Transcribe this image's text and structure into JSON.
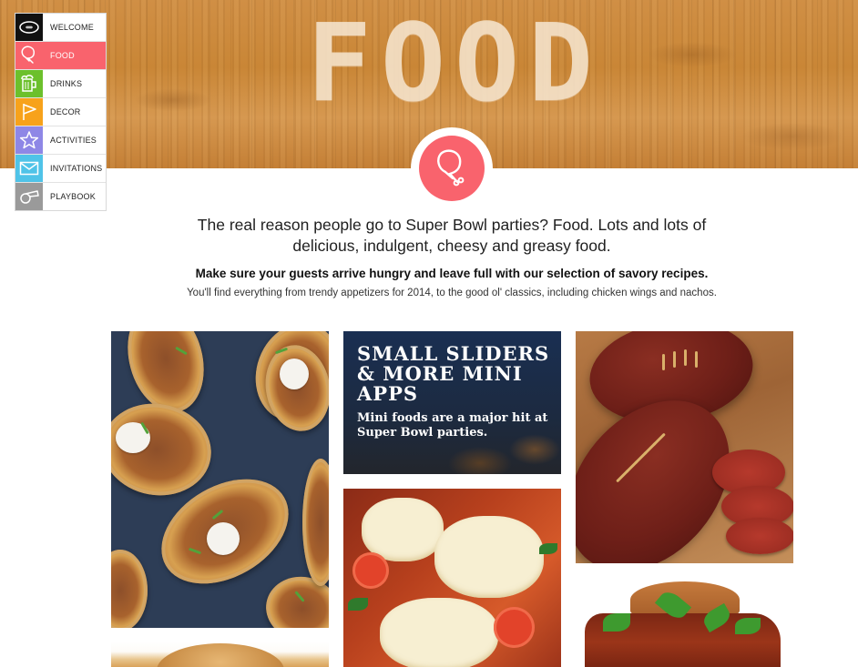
{
  "hero": {
    "title": "FOOD"
  },
  "nav": {
    "items": [
      {
        "label": "WELCOME",
        "icon": "football-icon",
        "color": "#111111"
      },
      {
        "label": "FOOD",
        "icon": "drumstick-icon",
        "color": "#f9636d",
        "active": true
      },
      {
        "label": "DRINKS",
        "icon": "beer-mug-icon",
        "color": "#6cc02c"
      },
      {
        "label": "DECOR",
        "icon": "pennant-icon",
        "color": "#f7a21b"
      },
      {
        "label": "ACTIVITIES",
        "icon": "star-icon",
        "color": "#8e87e6"
      },
      {
        "label": "INVITATIONS",
        "icon": "envelope-icon",
        "color": "#4fc3e8"
      },
      {
        "label": "PLAYBOOK",
        "icon": "whistle-icon",
        "color": "#9a9a9a"
      }
    ]
  },
  "badge": {
    "icon": "drumstick-icon",
    "color": "#f9636d"
  },
  "intro": {
    "lead": "The real reason people go to Super Bowl parties? Food. Lots and lots of delicious, indulgent, cheesy and greasy food.",
    "bold": "Make sure your guests arrive hungry and leave full with our selection of savory recipes.",
    "small": "You'll find everything from trendy appetizers for 2014, to the good ol' classics, including chicken wings and nachos."
  },
  "tiles": {
    "sliders": {
      "title": "SMALL SLIDERS & MORE MINI APPS",
      "subtitle": "Mini foods are a major hit at Super Bowl parties."
    }
  }
}
